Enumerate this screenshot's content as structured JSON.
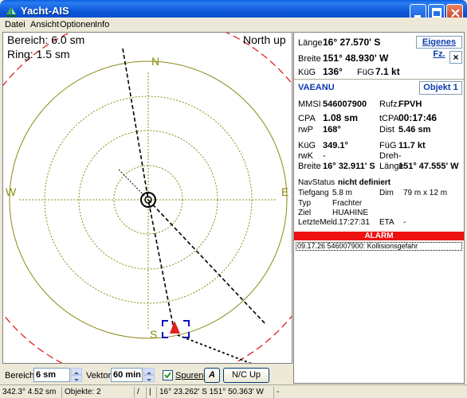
{
  "window": {
    "title": "Yacht-AIS"
  },
  "menu": {
    "items": [
      "Datei",
      "Ansicht",
      "Optionen",
      "Info"
    ]
  },
  "map": {
    "range_text": "Bereich: 6.0 sm",
    "ring_text": "Ring: 1.5 sm",
    "orientation": "North up",
    "compass": {
      "n": "N",
      "s": "S",
      "w": "W",
      "e": "E"
    }
  },
  "own_ship": {
    "laenge_label": "Länge",
    "laenge_value": "16° 27.570' S",
    "breite_label": "Breite",
    "breite_value": "151° 48.930' W",
    "kueg_label": "KüG",
    "kueg_value": "136°",
    "fueg_label": "FüG",
    "fueg_value": "7.1 kt",
    "own_button": "Eigenes Fz.",
    "close_button": "×"
  },
  "target": {
    "name": "VAEANU",
    "object_button": "Objekt 1",
    "mmsi_label": "MMSI",
    "mmsi_value": "546007900",
    "rufz_label": "Rufz.",
    "rufz_value": "FPVH",
    "cpa_label": "CPA",
    "cpa_value": "1.08 sm",
    "tcpa_label": "tCPA",
    "tcpa_value": "00:17:46",
    "rwp_label": "rwP",
    "rwp_value": "168°",
    "dist_label": "Dist",
    "dist_value": "5.46 sm",
    "kueg_label": "KüG",
    "kueg_value": "349.1°",
    "fueg_label": "FüG",
    "fueg_value": "11.7 kt",
    "rwk_label": "rwK",
    "rwk_value": "-",
    "dreh_label": "Dreh",
    "dreh_value": "-",
    "breite_label": "Breite",
    "breite_value": "16° 32.911' S",
    "laenge_label": "Länge",
    "laenge_value": "151° 47.555' W",
    "navstatus_label": "NavStatus",
    "navstatus_value": "nicht definiert",
    "tiefgang_label": "Tiefgang",
    "tiefgang_value": "5.8 m",
    "dim_label": "Dim",
    "dim_value": "79 m x 12 m",
    "typ_label": "Typ",
    "typ_value": "Frachter",
    "ziel_label": "Ziel",
    "ziel_value": "HUAHINE",
    "letzte_label": "LetzteMeld.",
    "letzte_value": "17:27:31",
    "eta_label": "ETA",
    "eta_value": "-"
  },
  "alarm": {
    "header": "ALARM",
    "entries": [
      "09.17.26 546007900: Kollisionsgefahr"
    ]
  },
  "controls": {
    "bereich_label": "Bereich",
    "bereich_value": "6 sm",
    "vektor_label": "Vektor",
    "vektor_value": "60 min",
    "spuren_label": "Spuren",
    "spuren_checked": true,
    "font_button": "A",
    "orientation_button": "N/C Up"
  },
  "status": {
    "heading_range": "342.3°  4.52 sm",
    "objects": "Objekte: 2",
    "cell3": "/",
    "cell4": "|",
    "position": "16° 23.262' S 151° 50.363' W",
    "cell6": "-"
  },
  "colors": {
    "ring": "#8b8b14",
    "range_circle": "#e02020",
    "target": "#e02020",
    "selection_box": "#1010c0"
  }
}
